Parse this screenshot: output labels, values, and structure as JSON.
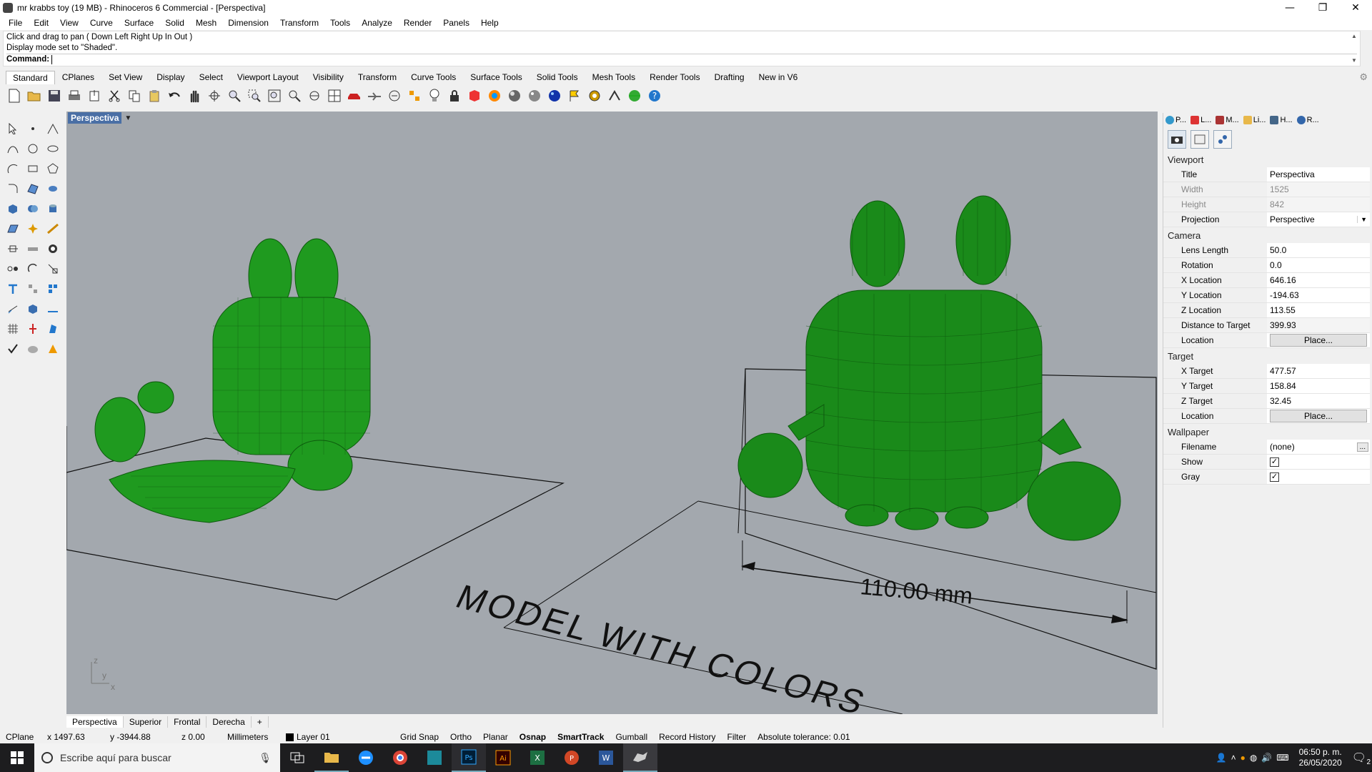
{
  "window": {
    "title": "mr krabbs toy (19 MB) - Rhinoceros 6 Commercial - [Perspectiva]",
    "min": "—",
    "max": "❐",
    "close": "✕"
  },
  "menu": [
    "File",
    "Edit",
    "View",
    "Curve",
    "Surface",
    "Solid",
    "Mesh",
    "Dimension",
    "Transform",
    "Tools",
    "Analyze",
    "Render",
    "Panels",
    "Help"
  ],
  "command_history": [
    "Click and drag to pan ( Down  Left  Right  Up  In  Out )",
    "Display mode set to \"Shaded\"."
  ],
  "command_prompt": "Command:",
  "toolbar_tabs": [
    "Standard",
    "CPlanes",
    "Set View",
    "Display",
    "Select",
    "Viewport Layout",
    "Visibility",
    "Transform",
    "Curve Tools",
    "Surface Tools",
    "Solid Tools",
    "Mesh Tools",
    "Render Tools",
    "Drafting",
    "New in V6"
  ],
  "viewport": {
    "title": "Perspectiva",
    "dimension_label": "110.00 mm",
    "floor_text": "MODEL WITH COLORS",
    "axis_z": "z",
    "axis_y": "y",
    "axis_x": "x"
  },
  "viewport_tabs": [
    "Perspectiva",
    "Superior",
    "Frontal",
    "Derecha",
    "+"
  ],
  "panel": {
    "tabs": [
      "P...",
      "L...",
      "M...",
      "Li...",
      "H...",
      "R..."
    ],
    "viewport_section": "Viewport",
    "viewport_props": [
      {
        "k": "Title",
        "v": "Perspectiva"
      },
      {
        "k": "Width",
        "v": "1525"
      },
      {
        "k": "Height",
        "v": "842"
      },
      {
        "k": "Projection",
        "v": "Perspective"
      }
    ],
    "camera_section": "Camera",
    "camera_props": [
      {
        "k": "Lens Length",
        "v": "50.0"
      },
      {
        "k": "Rotation",
        "v": "0.0"
      },
      {
        "k": "X Location",
        "v": "646.16"
      },
      {
        "k": "Y Location",
        "v": "-194.63"
      },
      {
        "k": "Z Location",
        "v": "113.55"
      },
      {
        "k": "Distance to Target",
        "v": "399.93"
      },
      {
        "k": "Location",
        "v": "Place..."
      }
    ],
    "target_section": "Target",
    "target_props": [
      {
        "k": "X Target",
        "v": "477.57"
      },
      {
        "k": "Y Target",
        "v": "158.84"
      },
      {
        "k": "Z Target",
        "v": "32.45"
      },
      {
        "k": "Location",
        "v": "Place..."
      }
    ],
    "wallpaper_section": "Wallpaper",
    "wallpaper_props": [
      {
        "k": "Filename",
        "v": "(none)"
      },
      {
        "k": "Show",
        "v": "✓"
      },
      {
        "k": "Gray",
        "v": "✓"
      }
    ],
    "filename_btn": "..."
  },
  "status": {
    "cplane": "CPlane",
    "x": "x 1497.63",
    "y": "y -3944.88",
    "z": "z 0.00",
    "units": "Millimeters",
    "layer": "Layer 01",
    "items": [
      "Grid Snap",
      "Ortho",
      "Planar",
      "Osnap",
      "SmartTrack",
      "Gumball",
      "Record History",
      "Filter"
    ],
    "tolerance": "Absolute tolerance: 0.01"
  },
  "taskbar": {
    "search_placeholder": "Escribe aquí para buscar",
    "time": "06:50 p. m.",
    "date": "26/05/2020",
    "notif_count": "2"
  },
  "colors": {
    "model_green": "#1a8a1a",
    "viewport_bg": "#a3a8ae",
    "accent": "#4a6fa5"
  }
}
